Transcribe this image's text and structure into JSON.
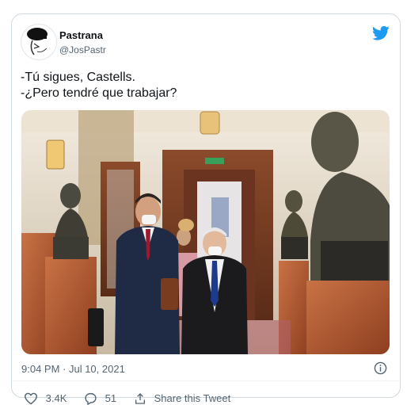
{
  "tweet": {
    "author_name": "Pastrana",
    "author_handle": "@JosPastr",
    "line1": "-Tú sigues, Castells.",
    "line2": "-¿Pero tendré que trabajar?",
    "timestamp": "9:04 PM · Jul 10, 2021",
    "likes": "3.4K",
    "replies": "51",
    "share_label": "Share this Tweet",
    "accent_color": "#1d9bf0"
  },
  "icons": [
    "bird-icon",
    "info-icon",
    "heart-icon",
    "reply-icon",
    "share-icon"
  ]
}
